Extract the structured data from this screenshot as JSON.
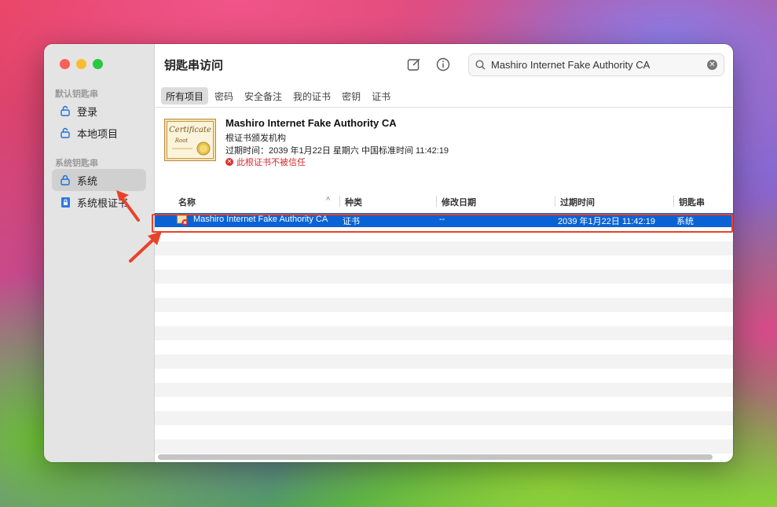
{
  "window": {
    "title": "钥匙串访问"
  },
  "sidebar": {
    "section_default": "默认钥匙串",
    "section_system": "系统钥匙串",
    "items": [
      {
        "label": "登录",
        "icon": "lock-open-icon"
      },
      {
        "label": "本地项目",
        "icon": "lock-open-icon"
      },
      {
        "label": "系统",
        "icon": "lock-icon",
        "selected": true
      },
      {
        "label": "系统根证书",
        "icon": "lock-cabinet-icon"
      }
    ]
  },
  "toolbar": {
    "search_value": "Mashiro Internet Fake Authority CA"
  },
  "tabs": [
    "所有项目",
    "密码",
    "安全备注",
    "我的证书",
    "密钥",
    "证书"
  ],
  "cert": {
    "name": "Mashiro Internet Fake Authority CA",
    "type": "根证书颁发机构",
    "expires": "过期时间：2039 年1月22日 星期六 中国标准时间 11:42:19",
    "warning": "此根证书不被信任",
    "img_title": "Certificate",
    "img_sub": "Root"
  },
  "table": {
    "columns": [
      "名称",
      "种类",
      "修改日期",
      "过期时间",
      "钥匙串"
    ],
    "rows": [
      {
        "name": "Mashiro Internet Fake Authority CA",
        "kind": "证书",
        "modified": "--",
        "expires": "2039 年1月22日 11:42:19",
        "keychain": "系统"
      }
    ]
  },
  "colors": {
    "accent": "#0a63d4",
    "annotation": "#e8432a",
    "warning": "#d8282a"
  }
}
